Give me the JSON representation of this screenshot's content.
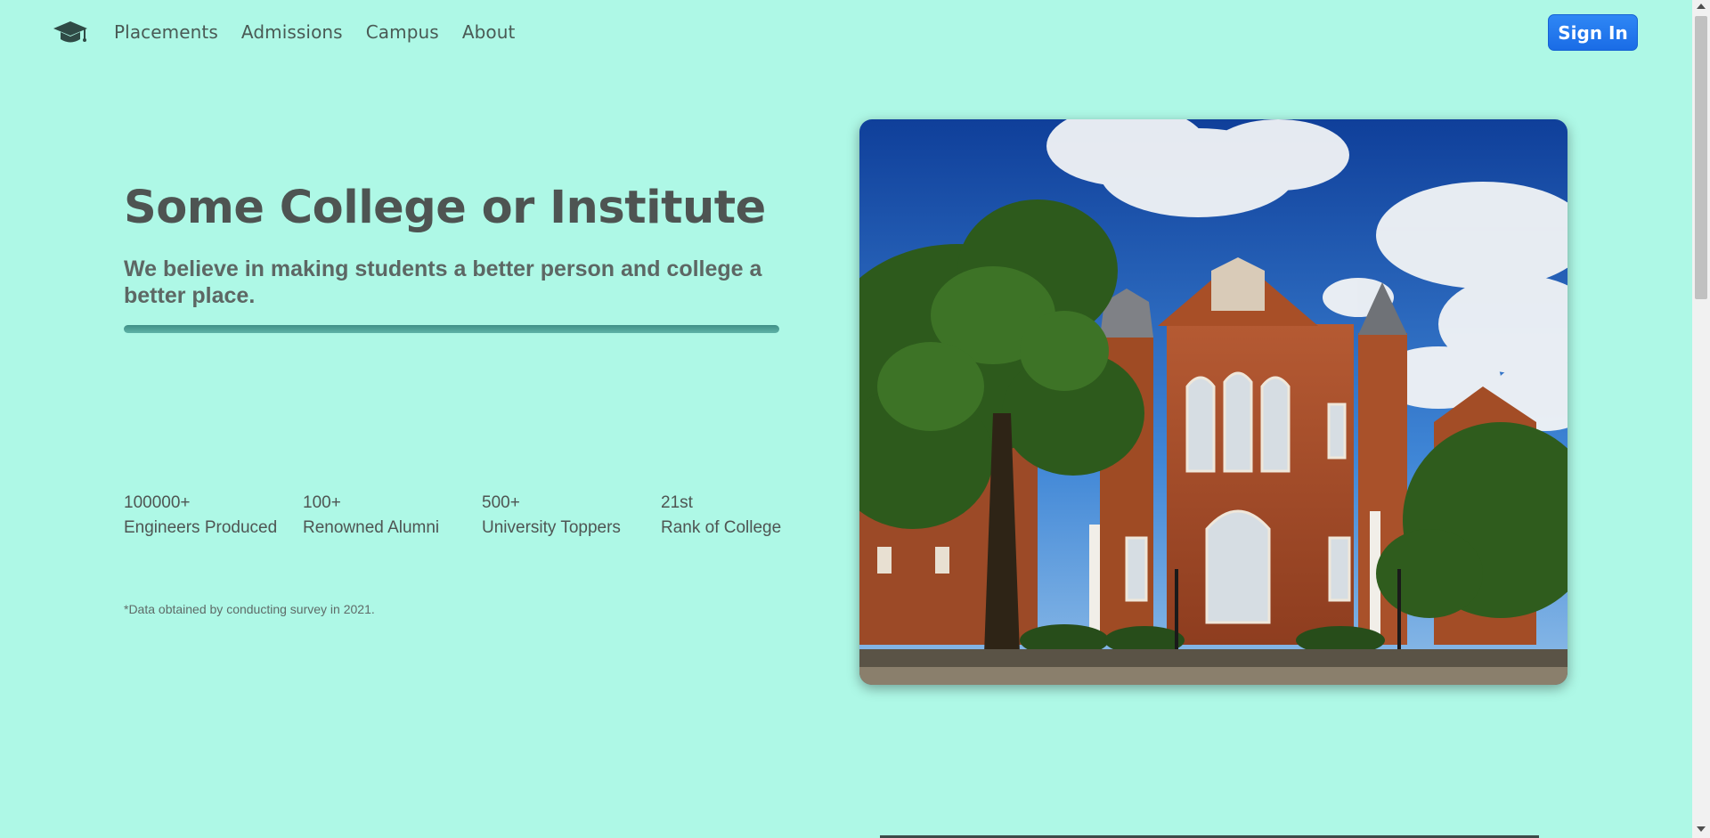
{
  "nav": {
    "logo_icon": "graduation-cap-icon",
    "links": [
      "Placements",
      "Admissions",
      "Campus",
      "About"
    ],
    "signin_label": "Sign In",
    "signin_color": "#1a6ce6"
  },
  "hero": {
    "title": "Some College or Institute",
    "subtitle": "We believe in making students a better person and college a better place.",
    "image_subject": "red-brick-gothic-college-building-photo"
  },
  "stats": [
    {
      "value": "100000+",
      "label": "Engineers Produced"
    },
    {
      "value": "100+",
      "label": "Renowned Alumni"
    },
    {
      "value": "500+",
      "label": "University Toppers"
    },
    {
      "value": "21st",
      "label": "Rank of College"
    }
  ],
  "footnote": "*Data obtained by conducting survey in 2021.",
  "theme": {
    "background": "#aef8e6",
    "accent_rule": "#4a9e94"
  }
}
